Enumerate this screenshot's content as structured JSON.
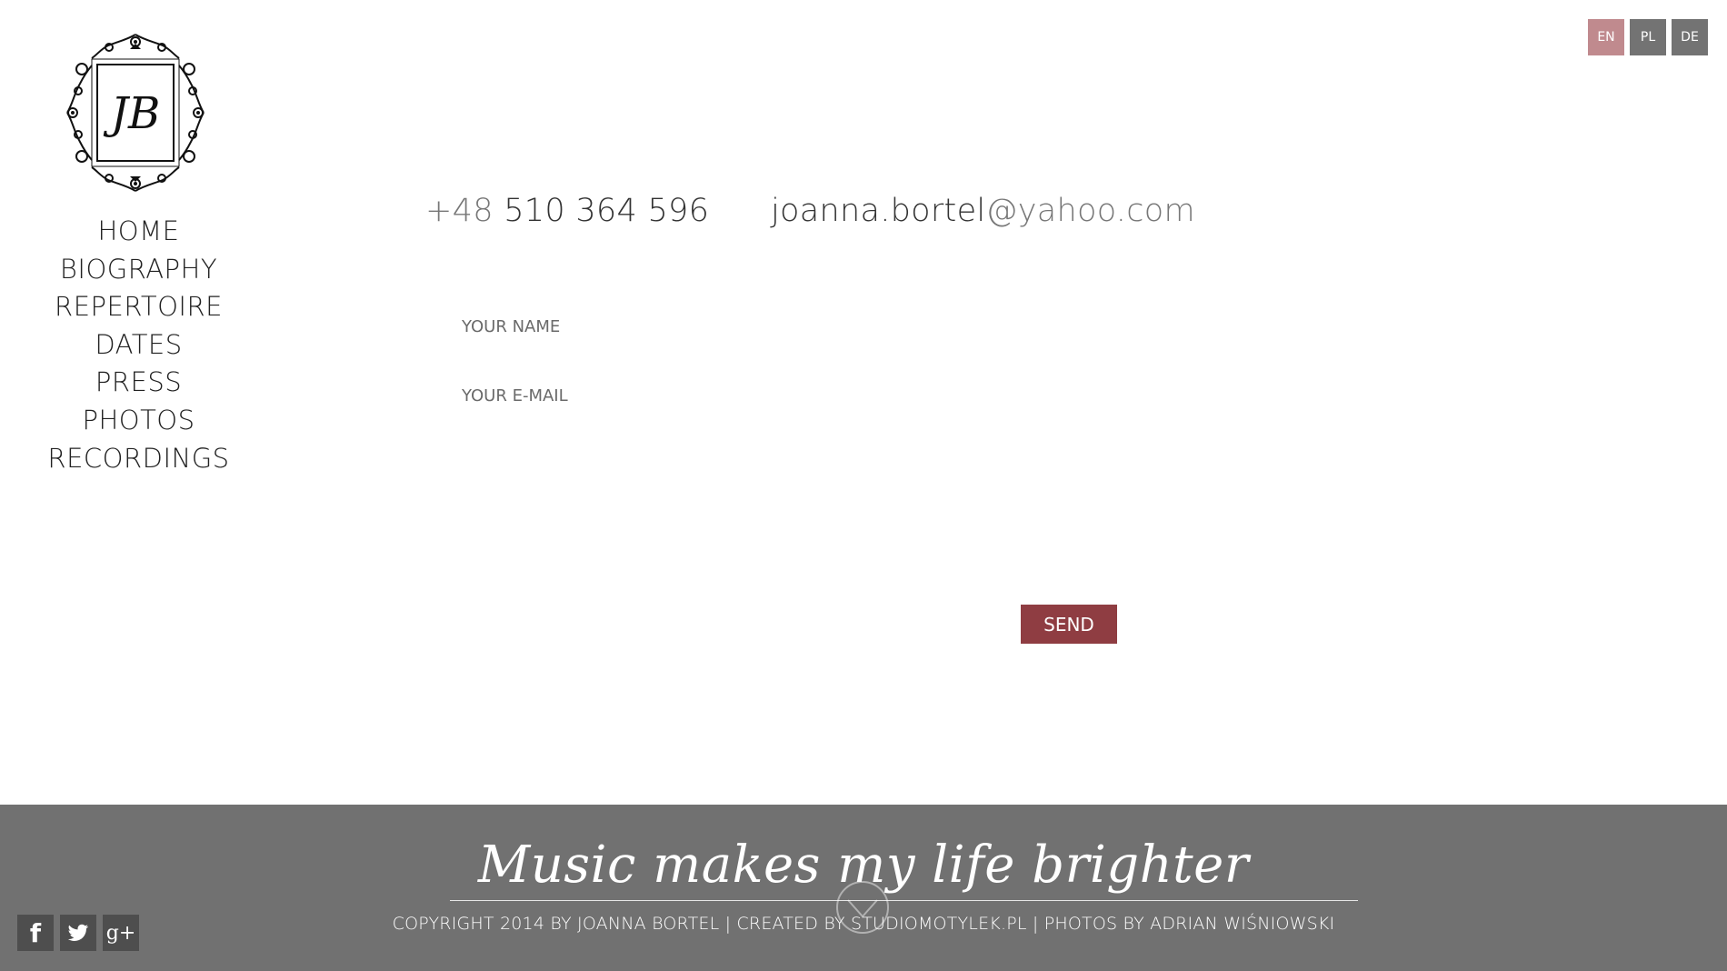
{
  "brand": {
    "logo_monogram": "JB",
    "logo_icon": "ornamental-frame-monogram"
  },
  "nav": {
    "items": [
      {
        "label": "HOME"
      },
      {
        "label": "BIOGRAPHY"
      },
      {
        "label": "REPERTOIRE"
      },
      {
        "label": "DATES"
      },
      {
        "label": "PRESS"
      },
      {
        "label": "PHOTOS"
      },
      {
        "label": "RECORDINGS"
      }
    ]
  },
  "languages": [
    {
      "label": "EN",
      "active": true
    },
    {
      "label": "PL",
      "active": false
    },
    {
      "label": "DE",
      "active": false
    }
  ],
  "contact": {
    "phone_prefix": "+48",
    "phone_number": "510 364 596",
    "email_user": "joanna.bortel",
    "email_domain": "@yahoo.com"
  },
  "form": {
    "name_placeholder": "YOUR NAME",
    "email_placeholder": "YOUR E-MAIL",
    "send_label": "SEND"
  },
  "footer": {
    "tagline": "Music makes my life brighter",
    "copyright": "COPYRIGHT 2014 BY JOANNA BORTEL | CREATED BY STUDIOMOTYLEK.PL | PHOTOS BY ADRIAN WIŚNIOWSKI",
    "social": [
      {
        "icon": "facebook-icon",
        "glyph": "f"
      },
      {
        "icon": "twitter-icon",
        "glyph": ""
      },
      {
        "icon": "google-plus-icon",
        "glyph": "g+"
      }
    ]
  },
  "colors": {
    "accent": "#8f3d42",
    "active_lang": "#c08a8e",
    "lang_bg": "#737373",
    "footer_bg": "#717171",
    "social_bg": "#4e4e4e"
  }
}
